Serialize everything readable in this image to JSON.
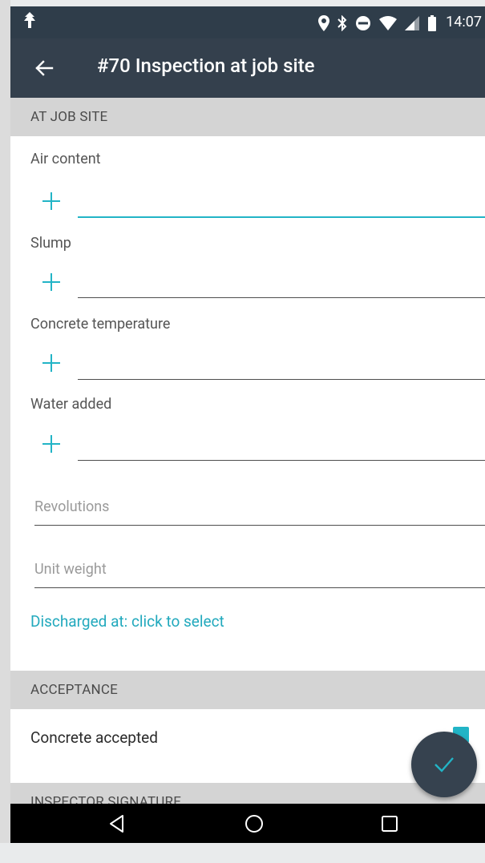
{
  "status_bar": {
    "time": "14:07",
    "icons": [
      "tree-icon",
      "location-icon",
      "bluetooth-icon",
      "do-not-disturb-icon",
      "wifi-icon",
      "signal-icon",
      "battery-icon"
    ]
  },
  "app_bar": {
    "title": "#70 Inspection at job site",
    "back_icon": "arrow-left-icon"
  },
  "sections": {
    "at_job_site": "AT JOB SITE",
    "acceptance": "ACCEPTANCE",
    "inspector_signature": "INSPECTOR SIGNATURE"
  },
  "fields": {
    "air_content": {
      "label": "Air content",
      "value": ""
    },
    "slump": {
      "label": "Slump",
      "value": ""
    },
    "concrete_temperature": {
      "label": "Concrete temperature",
      "value": ""
    },
    "water_added": {
      "label": "Water added",
      "value": ""
    },
    "revolutions": {
      "placeholder": "Revolutions",
      "value": ""
    },
    "unit_weight": {
      "placeholder": "Unit weight",
      "value": ""
    }
  },
  "discharged_link": "Discharged at: click to select",
  "acceptance": {
    "concrete_accepted_label": "Concrete accepted",
    "checked": true
  },
  "colors": {
    "accent": "#22b4c6",
    "app_bar": "#34404d",
    "status_bar": "#2f3d4a",
    "section_header": "#d4d4d4"
  },
  "fab_icon": "check-icon",
  "nav_bar": [
    "back-triangle-icon",
    "home-circle-icon",
    "recents-square-icon"
  ]
}
